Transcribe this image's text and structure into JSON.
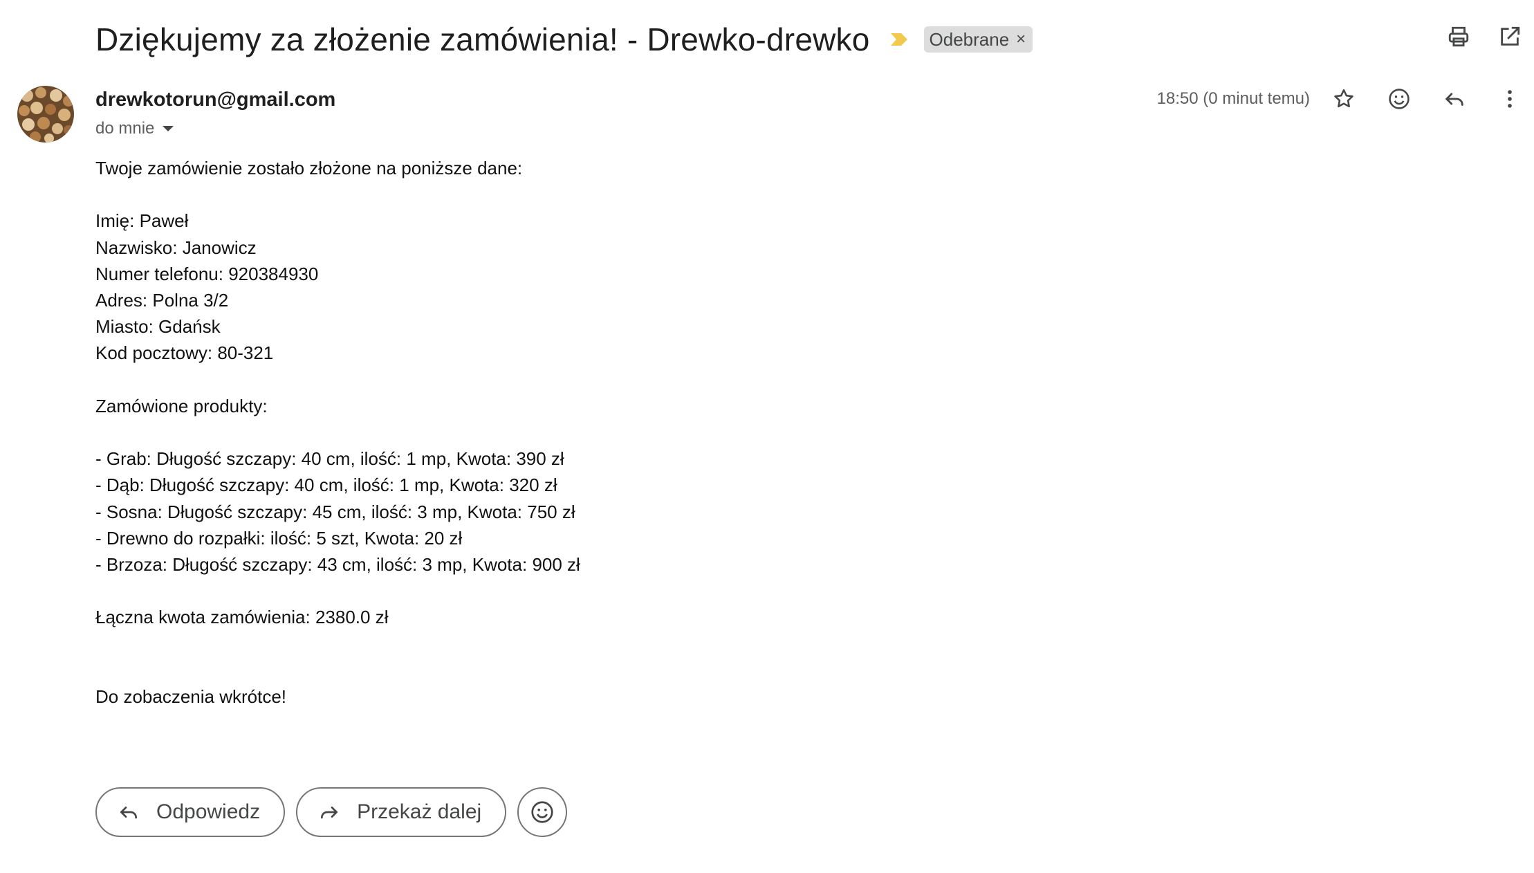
{
  "email": {
    "subject": "Dziękujemy za złożenie zamówienia! - Drewko-drewko",
    "label": "Odebrane",
    "sender": "drewkotorun@gmail.com",
    "recipient": "do mnie",
    "time": "18:50 (0 minut temu)",
    "body_lines": [
      "Twoje zamówienie zostało złożone na poniższe dane:",
      "",
      "Imię: Paweł",
      "Nazwisko: Janowicz",
      "Numer telefonu: 920384930",
      "Adres: Polna 3/2",
      "Miasto: Gdańsk",
      "Kod pocztowy: 80-321",
      "",
      "Zamówione produkty:",
      "",
      "- Grab: Długość szczapy: 40 cm, ilość: 1 mp, Kwota: 390 zł",
      "- Dąb: Długość szczapy: 40 cm, ilość: 1 mp, Kwota: 320 zł",
      "- Sosna: Długość szczapy: 45 cm, ilość: 3 mp, Kwota: 750 zł",
      "- Drewno do rozpałki: ilość: 5 szt, Kwota: 20 zł",
      "- Brzoza: Długość szczapy: 43 cm, ilość: 3 mp, Kwota: 900 zł",
      "",
      "Łączna kwota zamówienia: 2380.0 zł",
      "",
      "",
      "Do zobaczenia wkrótce!"
    ]
  },
  "actions": {
    "reply_label": "Odpowiedz",
    "forward_label": "Przekaż dalej"
  },
  "icons": {
    "importance": "importance-marker-icon",
    "print": "print-icon",
    "open_new_window": "open-in-new-window-icon",
    "star": "star-icon",
    "emoji": "emoji-reaction-icon",
    "reply": "reply-icon",
    "more": "more-vertical-icon",
    "forward": "forward-icon"
  },
  "colors": {
    "importance": "#f2c94c",
    "label_bg": "#dddddd",
    "text": "#1f1f1f",
    "muted": "#5e5e5e",
    "outline": "#747775"
  }
}
